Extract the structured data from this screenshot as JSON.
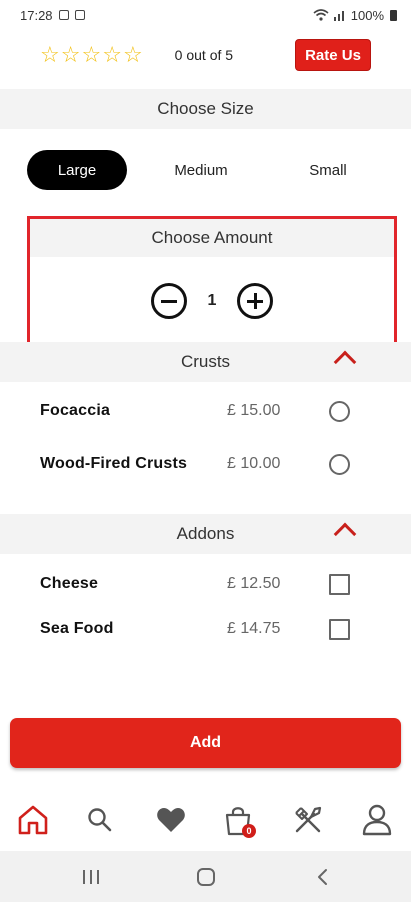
{
  "status_bar": {
    "time": "17:28",
    "battery": "100%"
  },
  "rating": {
    "stars_total": 5,
    "stars_filled": 0,
    "text": "0 out of 5",
    "button_label": "Rate Us"
  },
  "size": {
    "header": "Choose Size",
    "options": [
      {
        "label": "Large",
        "selected": true
      },
      {
        "label": "Medium",
        "selected": false
      },
      {
        "label": "Small",
        "selected": false
      }
    ]
  },
  "amount": {
    "header": "Choose Amount",
    "quantity": "1"
  },
  "crusts": {
    "header": "Crusts",
    "items": [
      {
        "name": "Focaccia",
        "price": "£ 15.00",
        "selected": false
      },
      {
        "name": "Wood-Fired Crusts",
        "price": "£ 10.00",
        "selected": false
      }
    ]
  },
  "addons": {
    "header": "Addons",
    "items": [
      {
        "name": "Cheese",
        "price": "£ 12.50",
        "checked": false
      },
      {
        "name": "Sea Food",
        "price": "£ 14.75",
        "checked": false
      }
    ]
  },
  "add_button": {
    "label": "Add"
  },
  "bottom_nav": {
    "items": [
      {
        "icon": "home-icon",
        "active": true
      },
      {
        "icon": "search-icon",
        "active": false
      },
      {
        "icon": "heart-icon",
        "active": false
      },
      {
        "icon": "cart-icon",
        "active": false,
        "badge": "0"
      },
      {
        "icon": "restaurant-icon",
        "active": false
      },
      {
        "icon": "user-icon",
        "active": false
      }
    ]
  },
  "colors": {
    "accent": "#e1251b",
    "highlight_border": "#e1252b",
    "star": "#f2c014",
    "chevron": "#c8201b"
  }
}
